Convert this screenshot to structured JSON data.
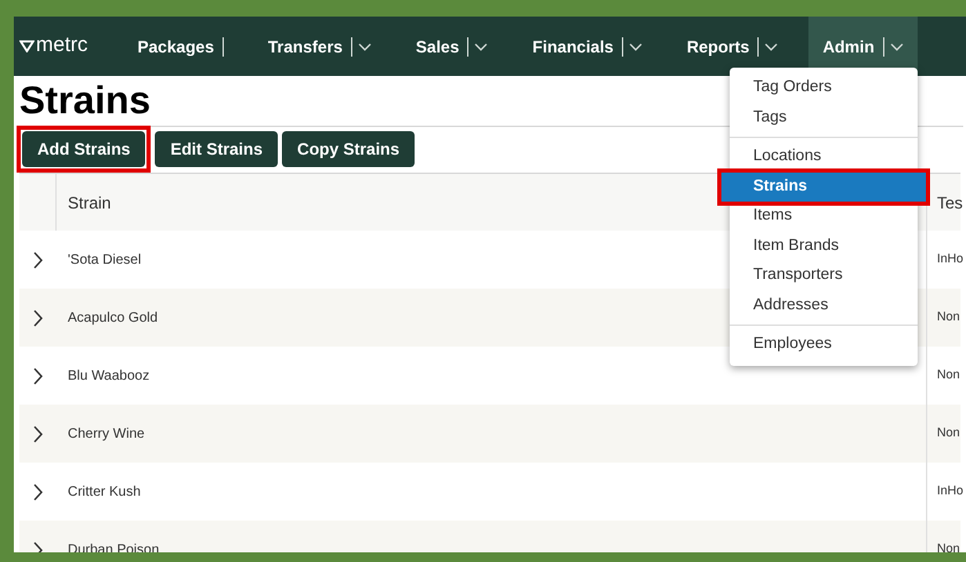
{
  "nav": {
    "logo": "metrc",
    "items": [
      {
        "label": "Packages",
        "caret": false,
        "selected": false
      },
      {
        "label": "Transfers",
        "caret": true,
        "selected": false
      },
      {
        "label": "Sales",
        "caret": true,
        "selected": false
      },
      {
        "label": "Financials",
        "caret": true,
        "selected": false
      },
      {
        "label": "Reports",
        "caret": true,
        "selected": false
      },
      {
        "label": "Admin",
        "caret": true,
        "selected": true
      }
    ]
  },
  "page_title": "Strains",
  "buttons": [
    {
      "label": "Add Strains",
      "highlighted": true
    },
    {
      "label": "Edit Strains",
      "highlighted": false
    },
    {
      "label": "Copy Strains",
      "highlighted": false
    }
  ],
  "table": {
    "columns": [
      "Strain",
      "Tes"
    ],
    "rows": [
      [
        "'Sota Diesel",
        "InHo"
      ],
      [
        "Acapulco Gold",
        "Non"
      ],
      [
        "Blu Waabooz",
        "Non"
      ],
      [
        "Cherry Wine",
        "Non"
      ],
      [
        "Critter Kush",
        "InHo"
      ],
      [
        "Durban Poison",
        "Non"
      ]
    ]
  },
  "admin_menu": {
    "groups": [
      [
        {
          "label": "Tag Orders",
          "selected": false,
          "highlighted": false
        },
        {
          "label": "Tags",
          "selected": false,
          "highlighted": false
        }
      ],
      [
        {
          "label": "Locations",
          "selected": false,
          "highlighted": false
        },
        {
          "label": "Strains",
          "selected": true,
          "highlighted": true
        },
        {
          "label": "Items",
          "selected": false,
          "highlighted": false
        },
        {
          "label": "Item Brands",
          "selected": false,
          "highlighted": false
        },
        {
          "label": "Transporters",
          "selected": false,
          "highlighted": false
        },
        {
          "label": "Addresses",
          "selected": false,
          "highlighted": false
        }
      ],
      [
        {
          "label": "Employees",
          "selected": false,
          "highlighted": false
        }
      ]
    ]
  }
}
